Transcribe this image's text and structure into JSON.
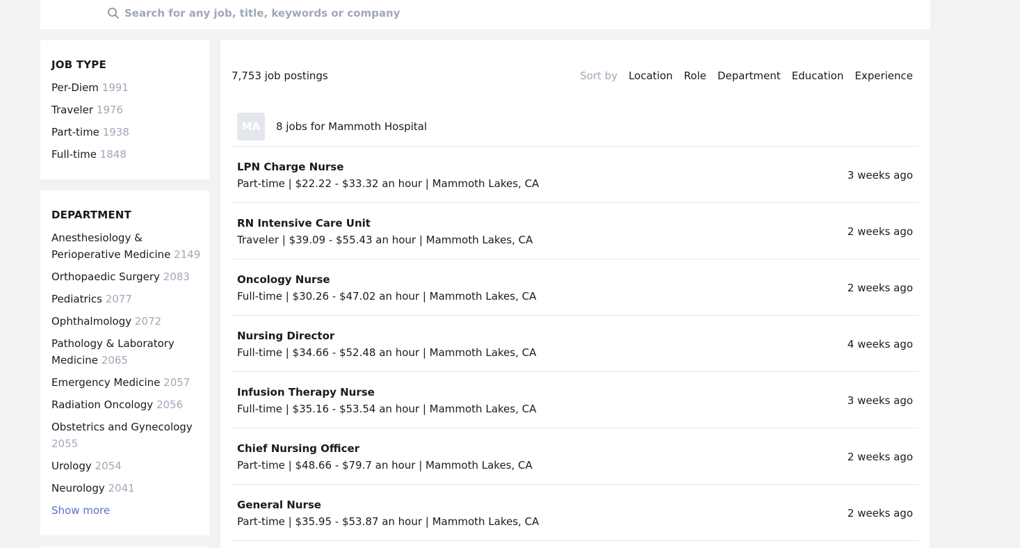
{
  "search": {
    "placeholder": "Search for any job, title, keywords or company",
    "icon": "search-icon"
  },
  "job_type": {
    "heading": "JOB TYPE",
    "items": [
      {
        "label": "Per-Diem",
        "count": "1991"
      },
      {
        "label": "Traveler",
        "count": "1976"
      },
      {
        "label": "Part-time",
        "count": "1938"
      },
      {
        "label": "Full-time",
        "count": "1848"
      }
    ]
  },
  "department": {
    "heading": "DEPARTMENT",
    "items": [
      {
        "label": "Anesthesiology &",
        "label2": "Perioperative Medicine",
        "count": "2149"
      },
      {
        "label": "Orthopaedic Surgery",
        "count": "2083"
      },
      {
        "label": "Pediatrics",
        "count": "2077"
      },
      {
        "label": "Ophthalmology",
        "count": "2072"
      },
      {
        "label": "Pathology & Laboratory",
        "label2": "Medicine",
        "count": "2065"
      },
      {
        "label": "Emergency Medicine",
        "count": "2057"
      },
      {
        "label": "Radiation Oncology",
        "count": "2056"
      },
      {
        "label": "Obstetrics and Gynecology",
        "count": "2055"
      },
      {
        "label": "Urology",
        "count": "2054"
      },
      {
        "label": "Neurology",
        "count": "2041"
      }
    ],
    "show_more": "Show more"
  },
  "results": {
    "total": "7,753 job postings",
    "sort_label": "Sort by",
    "sort_options": [
      "Location",
      "Role",
      "Department",
      "Education",
      "Experience"
    ]
  },
  "company": {
    "initials": "MA",
    "text": "8 jobs for Mammoth Hospital"
  },
  "jobs": [
    {
      "title": "LPN Charge Nurse",
      "meta": "Part-time | $22.22 - $33.32 an hour | Mammoth Lakes, CA",
      "ago": "3 weeks ago"
    },
    {
      "title": "RN Intensive Care Unit",
      "meta": "Traveler | $39.09 - $55.43 an hour | Mammoth Lakes, CA",
      "ago": "2 weeks ago"
    },
    {
      "title": "Oncology Nurse",
      "meta": "Full-time | $30.26 - $47.02 an hour | Mammoth Lakes, CA",
      "ago": "2 weeks ago"
    },
    {
      "title": "Nursing Director",
      "meta": "Full-time | $34.66 - $52.48 an hour | Mammoth Lakes, CA",
      "ago": "4 weeks ago"
    },
    {
      "title": "Infusion Therapy Nurse",
      "meta": "Full-time | $35.16 - $53.54 an hour | Mammoth Lakes, CA",
      "ago": "3 weeks ago"
    },
    {
      "title": "Chief Nursing Officer",
      "meta": "Part-time | $48.66 - $79.7 an hour | Mammoth Lakes, CA",
      "ago": "2 weeks ago"
    },
    {
      "title": "General Nurse",
      "meta": "Part-time | $35.95 - $53.87 an hour | Mammoth Lakes, CA",
      "ago": "2 weeks ago"
    }
  ]
}
